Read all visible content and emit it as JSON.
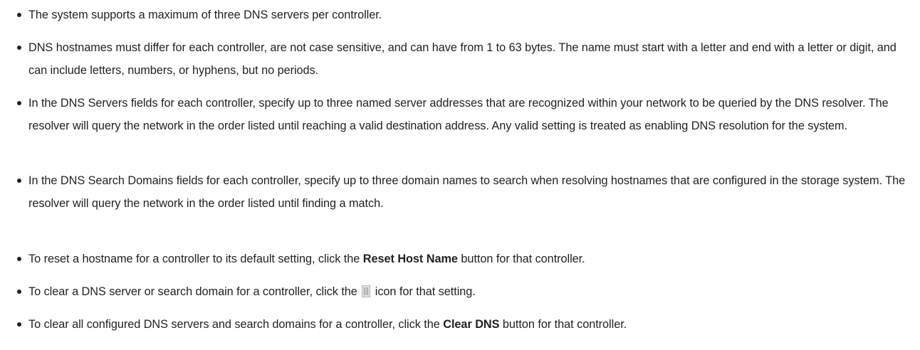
{
  "items": [
    {
      "text": "The system supports a maximum of three DNS servers per controller."
    },
    {
      "text": "DNS hostnames must differ for each controller, are not case sensitive, and can have from 1 to 63 bytes. The name must start with a letter and end with a letter or digit, and can include letters, numbers, or hyphens, but no periods."
    },
    {
      "text": "In the DNS Servers fields for each controller, specify up to three named server addresses that are recognized within your network to be queried by the DNS resolver. The resolver will query the network in the order listed until reaching a valid destination address. Any valid setting is treated as enabling DNS resolution for the system."
    },
    {
      "text": "In the DNS Search Domains fields for each controller, specify up to three domain names to search when resolving hostnames that are configured in the storage system. The resolver will query the network in the order listed until finding a match."
    },
    {
      "before": "To reset a hostname for a controller to its default setting, click the ",
      "bold": "Reset Host Name",
      "after": " button for that controller."
    },
    {
      "before": "To clear a DNS server or search domain for a controller, click the ",
      "icon": "trash-icon",
      "after": " icon for that setting."
    },
    {
      "before": "To clear all configured DNS servers and search domains for a controller, click the ",
      "bold": "Clear DNS",
      "after": " button for that controller."
    }
  ],
  "colors": {
    "text": "#231f20",
    "icon_fill": "#e4e4e4",
    "icon_stroke": "#8a8a8a"
  }
}
